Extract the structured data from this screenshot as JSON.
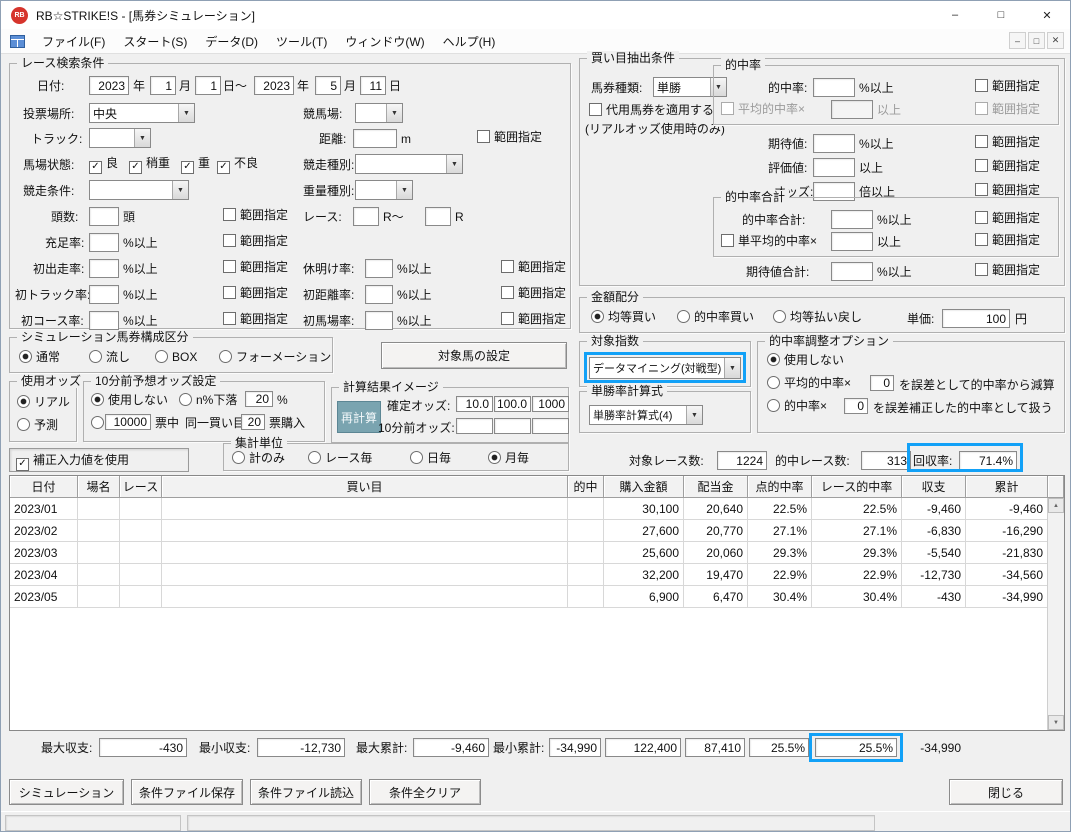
{
  "window": {
    "title": "RB☆STRIKE!S - [馬券シミュレーション]",
    "minimize": "–",
    "maximize": "□",
    "close": "✕",
    "mdi_minimize": "–",
    "mdi_restore": "□",
    "mdi_close": "✕",
    "icon_text": "RB"
  },
  "menubar": {
    "items": [
      "ファイル(F)",
      "スタート(S)",
      "データ(D)",
      "ツール(T)",
      "ウィンドウ(W)",
      "ヘルプ(H)"
    ]
  },
  "common": {
    "range": "範囲指定",
    "pct": "%以上",
    "ge": "以上",
    "bai": "倍以上"
  },
  "race_search": {
    "title": "レース検索条件",
    "date": {
      "label": "日付:",
      "y1": "2023",
      "m1": "1",
      "d1": "1",
      "sep": "日～",
      "y2": "2023",
      "m2": "5",
      "d2": "11",
      "u_year": "年",
      "u_month": "月",
      "u_day": "日"
    },
    "place": {
      "label": "投票場所:",
      "value": "中央"
    },
    "course": {
      "label": "競馬場:",
      "value": ""
    },
    "track": {
      "label": "トラック:",
      "value": ""
    },
    "dist": {
      "label": "距離:",
      "value": "",
      "unit": "m"
    },
    "baba": {
      "label": "馬場状態:",
      "o": [
        "良",
        "稍重",
        "重",
        "不良"
      ]
    },
    "kind": {
      "label": "競走種別:",
      "value": ""
    },
    "cond": {
      "label": "競走条件:",
      "value": ""
    },
    "weight": {
      "label": "重量種別:",
      "value": ""
    },
    "heads": {
      "label": "頭数:",
      "unit": "頭",
      "value": ""
    },
    "race": {
      "label": "レース:",
      "sep": "R～",
      "unit": "R",
      "from": "",
      "to": ""
    },
    "rate1": {
      "label": "充足率:",
      "value": ""
    },
    "rate2": {
      "label": "初出走率:",
      "value": ""
    },
    "rate3": {
      "label": "休明け率:",
      "value": ""
    },
    "rate4": {
      "label": "初トラック率:",
      "value": ""
    },
    "rate5": {
      "label": "初距離率:",
      "value": ""
    },
    "rate6": {
      "label": "初コース率:",
      "value": ""
    },
    "rate7": {
      "label": "初馬場率:",
      "value": ""
    }
  },
  "sim_kind": {
    "title": "シミュレーション馬券構成区分",
    "o": [
      "通常",
      "流し",
      "BOX",
      "フォーメーション"
    ],
    "selected": "通常"
  },
  "target_btn": "対象馬の設定",
  "odds_use": {
    "title": "使用オッズ",
    "o": [
      "リアル",
      "予測"
    ],
    "selected": "リアル"
  },
  "pre10": {
    "title": "10分前予想オッズ設定",
    "none": "使用しない",
    "drop": "n%下落",
    "drop_v": "20",
    "pct": "%",
    "votes": "10000",
    "votes_u": "票中",
    "same": "同一買い目",
    "buy": "20",
    "buy_u": "票購入",
    "selected": "使用しない"
  },
  "calc": {
    "title": "計算結果イメージ",
    "recalc": "再計算",
    "fixed": "確定オッズ:",
    "f": [
      "10.0",
      "100.0",
      "1000"
    ],
    "pre": "10分前オッズ:",
    "p": [
      "",
      "",
      ""
    ]
  },
  "hosei": "補正入力値を使用",
  "agg": {
    "title": "集計単位",
    "o": [
      "計のみ",
      "レース毎",
      "日毎",
      "月毎"
    ],
    "selected": "月毎"
  },
  "extract": {
    "title": "買い目抽出条件",
    "type_l": "馬券種類:",
    "type_v": "単勝",
    "sub": "代用馬券を適用する",
    "sub_note": "(リアルオッズ使用時のみ)",
    "hit": {
      "title": "的中率",
      "l": "的中率:",
      "avg": "平均的中率×"
    },
    "exp_l": "期待値:",
    "eval_l": "評価値:",
    "odds_l": "オッズ:",
    "hitsum": {
      "title": "的中率合計",
      "l": "的中率合計:",
      "avg": "単平均的中率×"
    },
    "expsum_l": "期待値合計:"
  },
  "alloc": {
    "title": "金額配分",
    "o": [
      "均等買い",
      "的中率買い",
      "均等払い戻し"
    ],
    "selected": "均等買い",
    "unit_l": "単価:",
    "unit_v": "100",
    "yen": "円"
  },
  "index": {
    "title": "対象指数",
    "value": "データマイニング(対戦型)"
  },
  "formula": {
    "title": "単勝率計算式",
    "value": "単勝率計算式(4)"
  },
  "adjust": {
    "title": "的中率調整オプション",
    "none": "使用しない",
    "avg_l": "平均的中率×",
    "avg_v": "0",
    "avg_t": "を誤差として的中率から減算",
    "rate_l": "的中率×",
    "rate_v": "0",
    "rate_t": "を誤差補正した的中率として扱う",
    "selected": "使用しない"
  },
  "stats": {
    "races_l": "対象レース数:",
    "races_v": "1224",
    "hits_l": "的中レース数:",
    "hits_v": "313",
    "rec_l": "回収率:",
    "rec_v": "71.4%"
  },
  "table": {
    "headers": [
      "日付",
      "場名",
      "レース",
      "買い目",
      "的中",
      "購入金額",
      "配当金",
      "点的中率",
      "レース的中率",
      "収支",
      "累計"
    ],
    "rows": [
      [
        "2023/01",
        "",
        "",
        "",
        "",
        "30,100",
        "20,640",
        "22.5%",
        "22.5%",
        "-9,460",
        "-9,460"
      ],
      [
        "2023/02",
        "",
        "",
        "",
        "",
        "27,600",
        "20,770",
        "27.1%",
        "27.1%",
        "-6,830",
        "-16,290"
      ],
      [
        "2023/03",
        "",
        "",
        "",
        "",
        "25,600",
        "20,060",
        "29.3%",
        "29.3%",
        "-5,540",
        "-21,830"
      ],
      [
        "2023/04",
        "",
        "",
        "",
        "",
        "32,200",
        "19,470",
        "22.9%",
        "22.9%",
        "-12,730",
        "-34,560"
      ],
      [
        "2023/05",
        "",
        "",
        "",
        "",
        "6,900",
        "6,470",
        "30.4%",
        "30.4%",
        "-430",
        "-34,990"
      ]
    ]
  },
  "summary": {
    "max_balance_l": "最大収支:",
    "max_balance": "-430",
    "min_balance_l": "最小収支:",
    "min_balance": "-12,730",
    "max_total_l": "最大累計:",
    "max_total": "-9,460",
    "min_total_l": "最小累計:",
    "min_total": "-34,990",
    "purchase_total": "122,400",
    "payout_total": "87,410",
    "point_hit_total": "25.5%",
    "race_hit_total": "25.5%",
    "balance_total": "-34,990"
  },
  "footer": {
    "sim": "シミュレーション",
    "save": "条件ファイル保存",
    "load": "条件ファイル読込",
    "clear": "条件全クリア",
    "close": "閉じる"
  },
  "colors": {
    "highlight": "#12a1f7"
  }
}
